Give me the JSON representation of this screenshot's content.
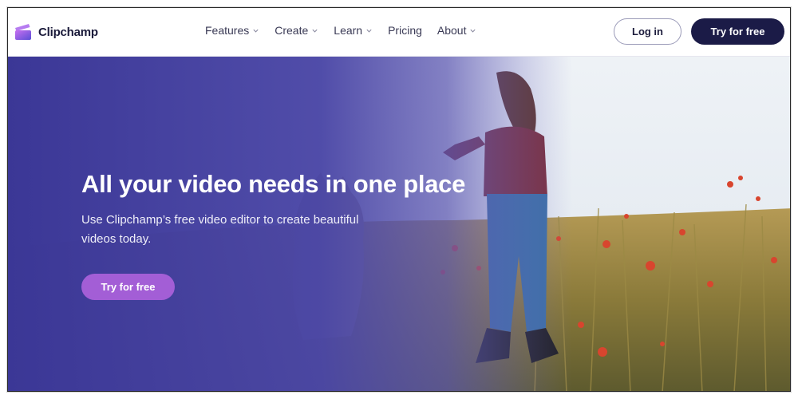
{
  "header": {
    "brand_name": "Clipchamp",
    "nav": [
      {
        "label": "Features",
        "has_dropdown": true,
        "icon": "chevron-down-icon"
      },
      {
        "label": "Create",
        "has_dropdown": true,
        "icon": "chevron-down-icon"
      },
      {
        "label": "Learn",
        "has_dropdown": true,
        "icon": "chevron-down-icon"
      },
      {
        "label": "Pricing",
        "has_dropdown": false
      },
      {
        "label": "About",
        "has_dropdown": true,
        "icon": "chevron-down-icon"
      }
    ],
    "login_label": "Log in",
    "try_label": "Try for free"
  },
  "hero": {
    "title": "All your video needs in one place",
    "subtitle": "Use Clipchamp’s free video editor to create beautiful videos today.",
    "cta_label": "Try for free"
  },
  "colors": {
    "header_bg": "#ffffff",
    "primary_dark": "#1b1b47",
    "hero_overlay": "#3e3a98",
    "cta_purple": "#a35ed6",
    "logo_purple": "#7b61d9"
  }
}
